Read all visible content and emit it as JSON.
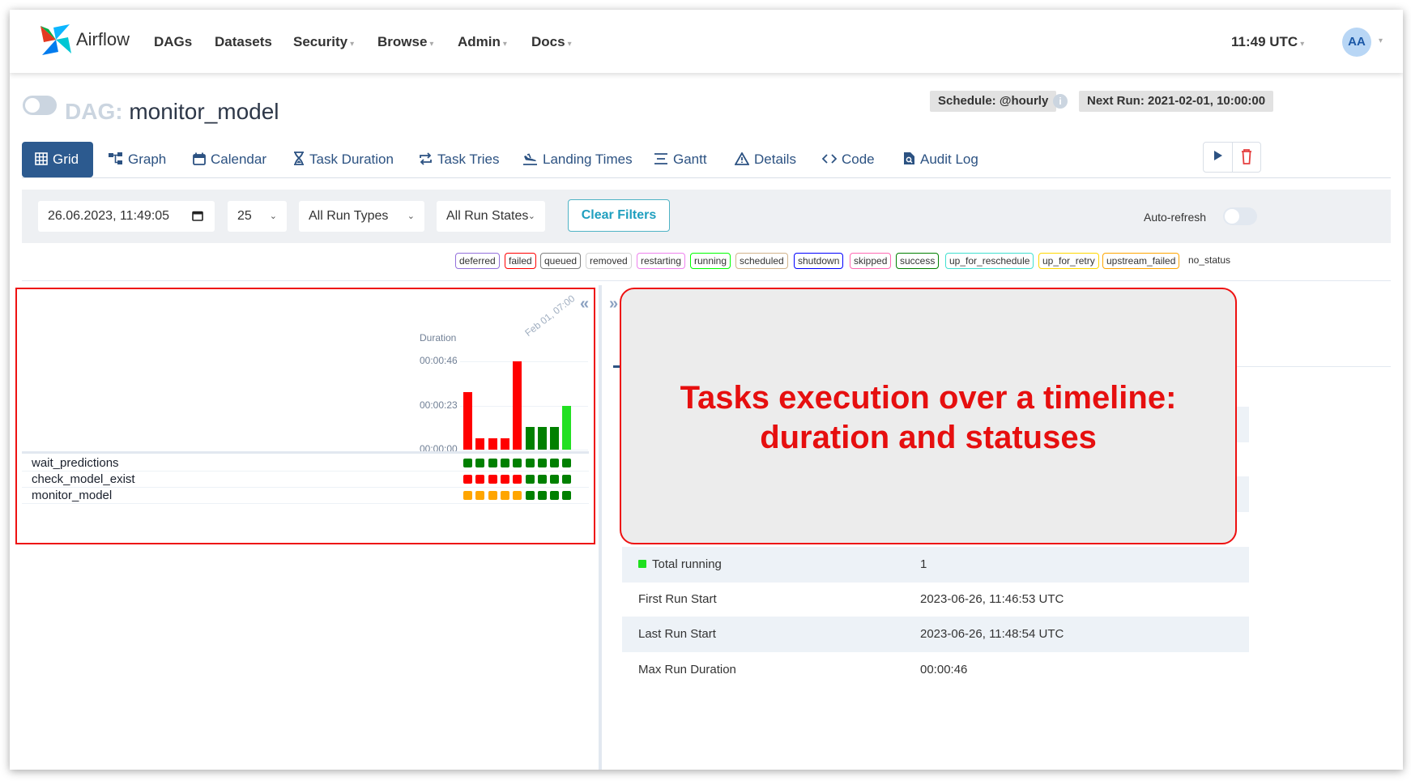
{
  "app": {
    "brand": "Airflow",
    "time": "11:49 UTC",
    "avatar": "AA"
  },
  "nav": [
    {
      "label": "DAGs",
      "dropdown": false
    },
    {
      "label": "Datasets",
      "dropdown": false
    },
    {
      "label": "Security",
      "dropdown": true
    },
    {
      "label": "Browse",
      "dropdown": true
    },
    {
      "label": "Admin",
      "dropdown": true
    },
    {
      "label": "Docs",
      "dropdown": true
    }
  ],
  "dag": {
    "prefix": "DAG:",
    "name": "monitor_model",
    "schedule": "Schedule: @hourly",
    "next_run": "Next Run: 2021-02-01, 10:00:00"
  },
  "tabs": [
    {
      "label": "Grid",
      "icon": "grid-icon",
      "active": true
    },
    {
      "label": "Graph",
      "icon": "graph-icon",
      "active": false
    },
    {
      "label": "Calendar",
      "icon": "calendar-icon",
      "active": false
    },
    {
      "label": "Task Duration",
      "icon": "hourglass-icon",
      "active": false
    },
    {
      "label": "Task Tries",
      "icon": "repeat-icon",
      "active": false
    },
    {
      "label": "Landing Times",
      "icon": "landing-icon",
      "active": false
    },
    {
      "label": "Gantt",
      "icon": "gantt-icon",
      "active": false
    },
    {
      "label": "Details",
      "icon": "warning-triangle-icon",
      "active": false
    },
    {
      "label": "Code",
      "icon": "code-icon",
      "active": false
    },
    {
      "label": "Audit Log",
      "icon": "file-search-icon",
      "active": false
    }
  ],
  "filters": {
    "datetime": "26.06.2023, 11:49:05",
    "num_runs": "25",
    "run_type": "All Run Types",
    "run_state": "All Run States",
    "clear_label": "Clear Filters",
    "autorefresh_label": "Auto-refresh"
  },
  "legend": [
    {
      "label": "deferred",
      "color": "#9370db"
    },
    {
      "label": "failed",
      "color": "#ff0000"
    },
    {
      "label": "queued",
      "color": "#808080"
    },
    {
      "label": "removed",
      "color": "#d3d3d3"
    },
    {
      "label": "restarting",
      "color": "#ee82ee"
    },
    {
      "label": "running",
      "color": "#00ff00"
    },
    {
      "label": "scheduled",
      "color": "#d2b48c"
    },
    {
      "label": "shutdown",
      "color": "#0000ff"
    },
    {
      "label": "skipped",
      "color": "#ff69b4"
    },
    {
      "label": "success",
      "color": "#008000"
    },
    {
      "label": "up_for_reschedule",
      "color": "#40e0d0"
    },
    {
      "label": "up_for_retry",
      "color": "#ffd700"
    },
    {
      "label": "upstream_failed",
      "color": "#ffa500"
    },
    {
      "label": "no_status",
      "color": ""
    }
  ],
  "chart_data": {
    "type": "bar",
    "ylabel": "Duration",
    "y_ticks": [
      "00:00:46",
      "00:00:23",
      "00:00:00"
    ],
    "ylim": [
      0,
      46
    ],
    "x_label_last": "Feb 01, 07:00",
    "runs": [
      {
        "duration_s": 30,
        "state": "failed"
      },
      {
        "duration_s": 6,
        "state": "failed"
      },
      {
        "duration_s": 6,
        "state": "failed"
      },
      {
        "duration_s": 6,
        "state": "failed"
      },
      {
        "duration_s": 46,
        "state": "failed"
      },
      {
        "duration_s": 12,
        "state": "success"
      },
      {
        "duration_s": 12,
        "state": "success"
      },
      {
        "duration_s": 12,
        "state": "success"
      },
      {
        "duration_s": 23,
        "state": "running"
      }
    ]
  },
  "tasks": [
    {
      "name": "wait_predictions",
      "states": [
        "success",
        "success",
        "success",
        "success",
        "success",
        "success",
        "success",
        "success",
        "success"
      ]
    },
    {
      "name": "check_model_exist",
      "states": [
        "failed",
        "failed",
        "failed",
        "failed",
        "failed",
        "success",
        "success",
        "success",
        "success"
      ]
    },
    {
      "name": "monitor_model",
      "states": [
        "upstream_failed",
        "upstream_failed",
        "upstream_failed",
        "upstream_failed",
        "upstream_failed",
        "success",
        "success",
        "success",
        "success"
      ]
    }
  ],
  "state_colors": {
    "success": "#008000",
    "failed": "#ff0000",
    "running": "#22e022",
    "upstream_failed": "#ffa500"
  },
  "details": [
    {
      "key": "Total running",
      "value": "1",
      "dot": true
    },
    {
      "key": "First Run Start",
      "value": "2023-06-26, 11:46:53 UTC",
      "dot": false
    },
    {
      "key": "Last Run Start",
      "value": "2023-06-26, 11:48:54 UTC",
      "dot": false
    },
    {
      "key": "Max Run Duration",
      "value": "00:00:46",
      "dot": false
    }
  ],
  "annotation": {
    "line1": "Tasks execution over a timeline:",
    "line2": "duration and statuses"
  }
}
